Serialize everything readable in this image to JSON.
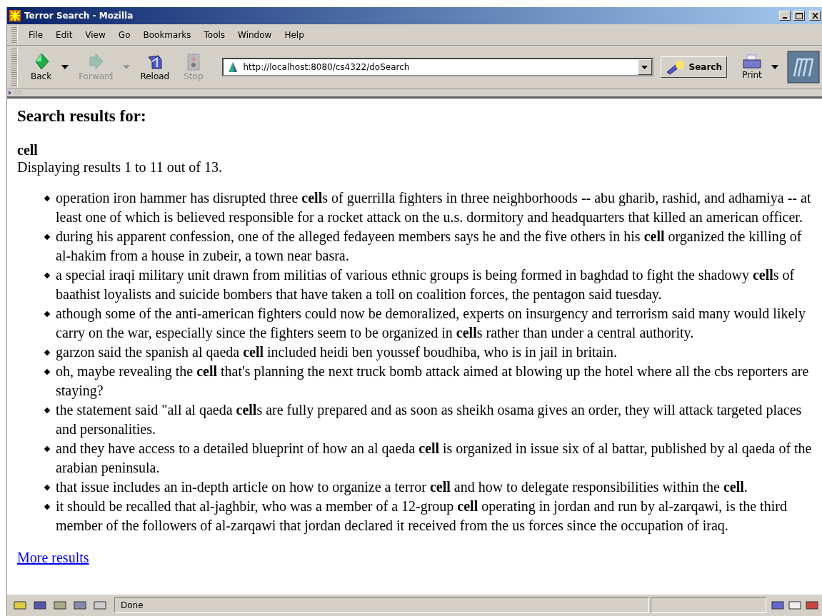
{
  "window": {
    "title": "Terror Search - Mozilla"
  },
  "menu": [
    "File",
    "Edit",
    "View",
    "Go",
    "Bookmarks",
    "Tools",
    "Window",
    "Help"
  ],
  "toolbar": {
    "buttons": [
      {
        "kind": "back",
        "label": "Back",
        "disabled": false,
        "dropdown": true
      },
      {
        "kind": "forward",
        "label": "Forward",
        "disabled": true,
        "dropdown": true
      },
      {
        "kind": "reload",
        "label": "Reload",
        "disabled": false,
        "dropdown": false
      },
      {
        "kind": "stop",
        "label": "Stop",
        "disabled": true,
        "dropdown": false
      }
    ],
    "address": "http://localhost:8080/cs4322/doSearch",
    "search_button": "Search",
    "print": "Print"
  },
  "page": {
    "heading": "Search results for:",
    "query": "cell",
    "summary": "Displaying results 1 to 11 out of 13.",
    "results": [
      "operation iron hammer has disrupted three **cell**s of guerrilla fighters in three neighborhoods -- abu gharib, rashid, and adhamiya -- at least one of which is believed responsible for a rocket attack on the u.s. dormitory and headquarters that killed an american officer.",
      "during his apparent confession, one of the alleged fedayeen members says he and the five others in his **cell** organized the killing of al-hakim from a house in zubeir, a town near basra.",
      "a special iraqi military unit drawn from militias of various ethnic groups is being formed in baghdad to fight the shadowy **cell**s of baathist loyalists and suicide bombers that have taken a toll on coalition forces, the pentagon said tuesday.",
      "athough some of the anti-american fighters could now be demoralized, experts on insurgency and terrorism said many would likely carry on the war, especially since the fighters seem to be organized in **cell**s rather than under a central authority.",
      "garzon said the spanish al qaeda **cell** included heidi ben youssef boudhiba, who is in jail in britain.",
      "oh, maybe revealing the **cell** that's planning the next truck bomb attack aimed at blowing up the hotel where all the cbs reporters are staying?",
      "the statement said \"all al qaeda **cell**s are fully prepared and as soon as sheikh osama gives an order, they will attack targeted places and personalities.",
      "and they have access to a detailed blueprint of how an al qaeda **cell** is organized in issue six of al battar, published by al qaeda of the arabian peninsula.",
      "that issue includes an in-depth article on how to organize a terror **cell** and how to delegate responsibilities within the **cell**.",
      "it should be recalled that al-jaghbir, who was a member of a 12-group **cell** operating in jordan and run by al-zarqawi, is the third member of the followers of al-zarqawi that jordan declared it received from the us forces since the occupation of iraq."
    ],
    "more_link": "More results"
  },
  "status_bar": {
    "text": "Done"
  }
}
